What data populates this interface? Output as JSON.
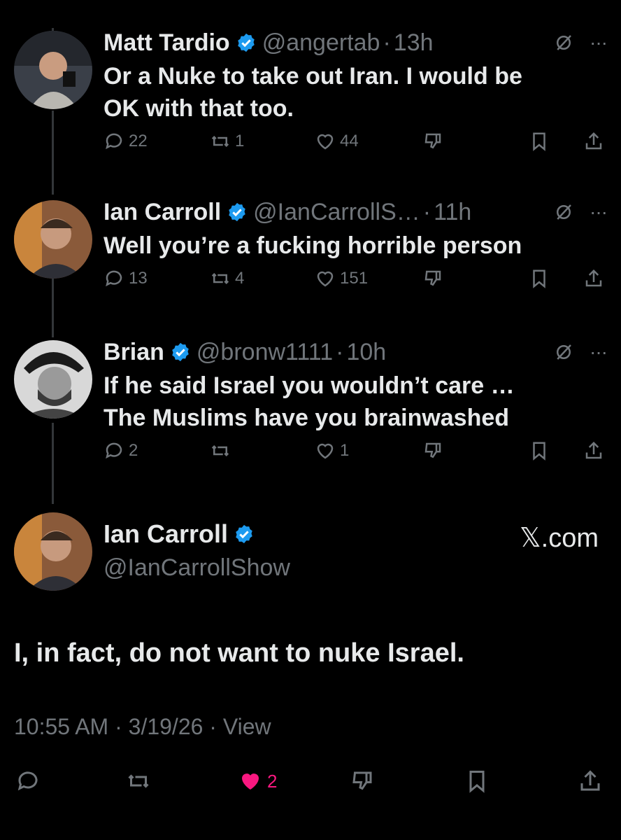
{
  "replies": [
    {
      "name": "Matt Tardio",
      "handle": "@angertab",
      "time": "13h",
      "text_line1": "Or a Nuke to take out Iran. I would be",
      "text_line2": "OK with that too.",
      "replies_count": "22",
      "reposts_count": "1",
      "likes_count": "44"
    },
    {
      "name": "Ian Carroll",
      "handle": "@IanCarrollS…",
      "time": "11h",
      "text_line1": "Well you’re a fucking horrible person",
      "replies_count": "13",
      "reposts_count": "4",
      "likes_count": "151"
    },
    {
      "name": "Brian",
      "handle": "@bronw1111",
      "time": "10h",
      "text_line1": "If he said Israel you wouldn’t care …",
      "text_line2": "The Muslims have you brainwashed",
      "replies_count": "2",
      "reposts_count": "",
      "likes_count": "1"
    }
  ],
  "main_post": {
    "name": "Ian Carroll",
    "handle": "@IanCarrollShow",
    "site": "𝕏.com",
    "text": "I, in fact, do not want to nuke Israel.",
    "timestamp": "10:55 AM · 3/19/26 · View",
    "likes_count": "2"
  },
  "colors": {
    "background": "#000000",
    "text": "#e7e9ea",
    "muted": "#71767b",
    "verified": "#1d9bf0",
    "liked": "#f91880"
  }
}
